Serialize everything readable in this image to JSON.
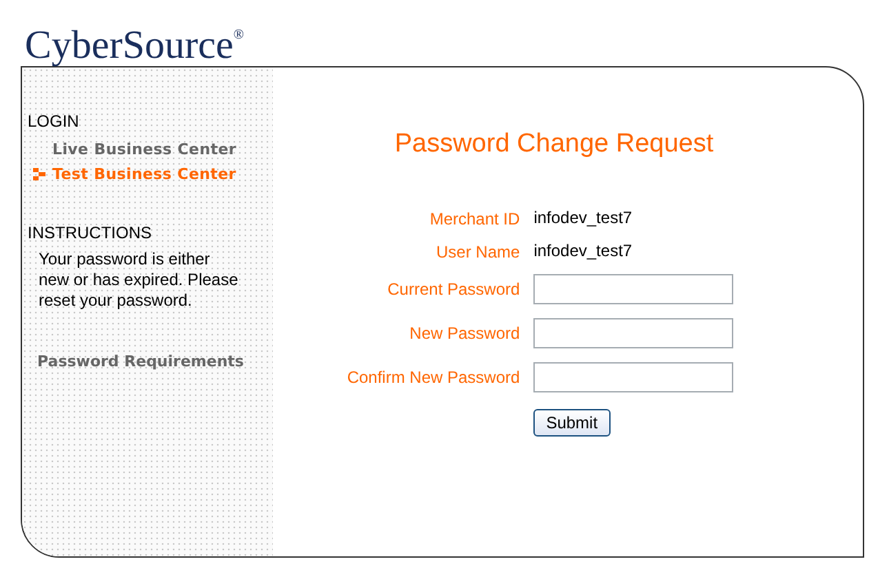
{
  "logo": "CyberSource$^{®}$",
  "sidebar": {
    "login_heading": "LOGIN",
    "login_items": [
      {
        "label": "Live Business Center",
        "selected": false
      },
      {
        "label": "Test Business Center",
        "selected": true
      }
    ],
    "instructions_heading": "INSTRUCTIONS",
    "instructions": "Your password is either new or has expired. Please reset your password.",
    "requirements_link": "Password Requirements"
  },
  "form": {
    "title": "Password Change Request",
    "rows": [
      {
        "kind": "text",
        "label": "Merchant ID",
        "value": "infodev_test7"
      },
      {
        "kind": "text",
        "label": "User Name",
        "value": "infodev_test7"
      },
      {
        "kind": "input",
        "label": "Current Password"
      },
      {
        "kind": "input",
        "label": "New Password"
      },
      {
        "kind": "input",
        "label": "Confirm New Password"
      }
    ],
    "submit": "Submit"
  }
}
